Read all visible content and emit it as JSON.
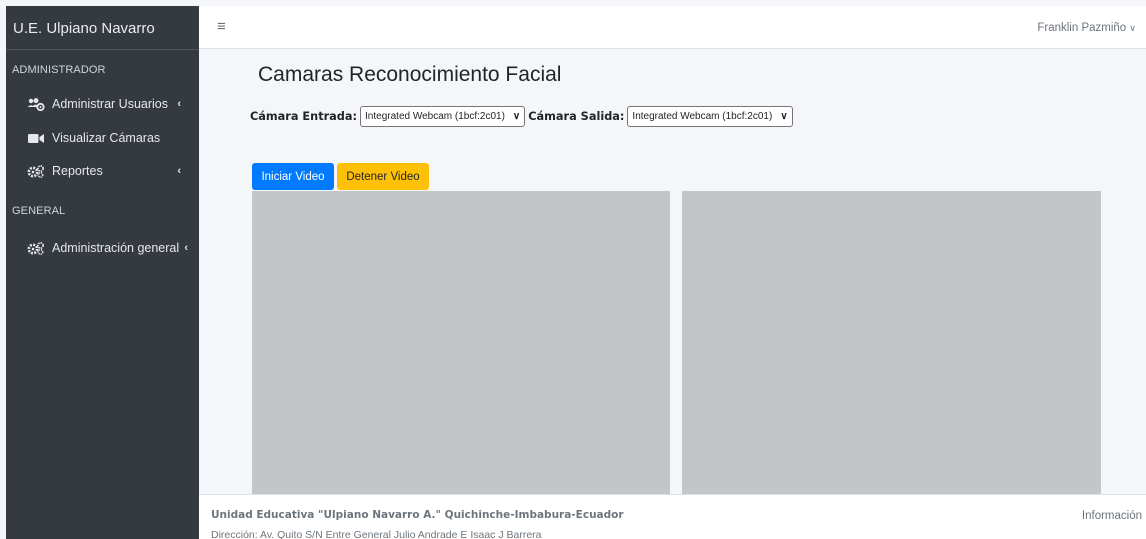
{
  "sidebar": {
    "brand": "U.E. Ulpiano Navarro",
    "section_admin": "ADMINISTRADOR",
    "section_general": "GENERAL",
    "items": [
      {
        "label": "Administrar Usuarios",
        "icon": "users-cog-icon",
        "has_chevron": true
      },
      {
        "label": "Visualizar Cámaras",
        "icon": "video-icon",
        "has_chevron": false
      },
      {
        "label": "Reportes",
        "icon": "cogs-icon",
        "has_chevron": true
      },
      {
        "label": "Administración general",
        "icon": "cogs-icon",
        "has_chevron": true
      }
    ]
  },
  "topbar": {
    "menu_icon": "hamburger-icon",
    "user_name": "Franklin Pazmiño"
  },
  "main": {
    "title": "Camaras Reconocimiento Facial",
    "camera_entry_label": "Cámara Entrada:",
    "camera_entry_value": "Integrated Webcam (1bcf:2c01)",
    "camera_exit_label": "Cámara Salida:",
    "camera_exit_value": "Integrated Webcam (1bcf:2c01)",
    "start_button": "Iniciar Video",
    "stop_button": "Detener Video"
  },
  "footer": {
    "title": "Unidad Educativa \"Ulpiano Navarro A.\" Quichinche-Imbabura-Ecuador",
    "address": "Dirección: Av. Quito S/N Entre General Julio Andrade E Isaac J Barrera",
    "info_link": "Información"
  },
  "colors": {
    "sidebar_bg": "#343a40",
    "primary": "#007bff",
    "warning": "#ffc107",
    "video_placeholder": "#c4c5c7"
  }
}
